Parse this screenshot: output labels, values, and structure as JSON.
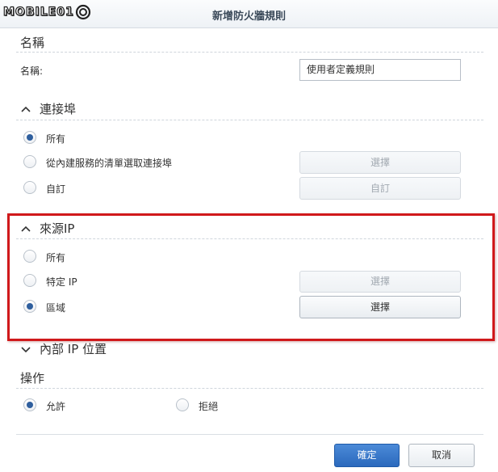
{
  "window": {
    "title": "新增防火牆規則",
    "logo_text": "MOBILE01"
  },
  "name_section": {
    "heading": "名稱",
    "field_label": "名稱:",
    "field_value": "使用者定義規則"
  },
  "port_section": {
    "heading": "連接埠",
    "options": [
      {
        "label": "所有",
        "checked": true
      },
      {
        "label": "從內建服務的清單選取連接埠",
        "checked": false,
        "button": "選擇",
        "button_state": "disabled"
      },
      {
        "label": "自訂",
        "checked": false,
        "button": "自訂",
        "button_state": "disabled"
      }
    ]
  },
  "source_ip_section": {
    "heading": "來源IP",
    "options": [
      {
        "label": "所有",
        "checked": false
      },
      {
        "label": "特定 IP",
        "checked": false,
        "button": "選擇",
        "button_state": "disabled"
      },
      {
        "label": "區域",
        "checked": true,
        "button": "選擇",
        "button_state": "enabled"
      }
    ]
  },
  "internal_ip_section": {
    "heading": "內部 IP 位置"
  },
  "action_section": {
    "heading": "操作",
    "options": [
      {
        "label": "允許",
        "checked": true
      },
      {
        "label": "拒絕",
        "checked": false
      }
    ]
  },
  "footer": {
    "ok_label": "確定",
    "cancel_label": "取消"
  },
  "colors": {
    "primary_button": "#2b69bd",
    "highlight_border": "#d0191b",
    "radio_checked": "#2f5f9e"
  }
}
